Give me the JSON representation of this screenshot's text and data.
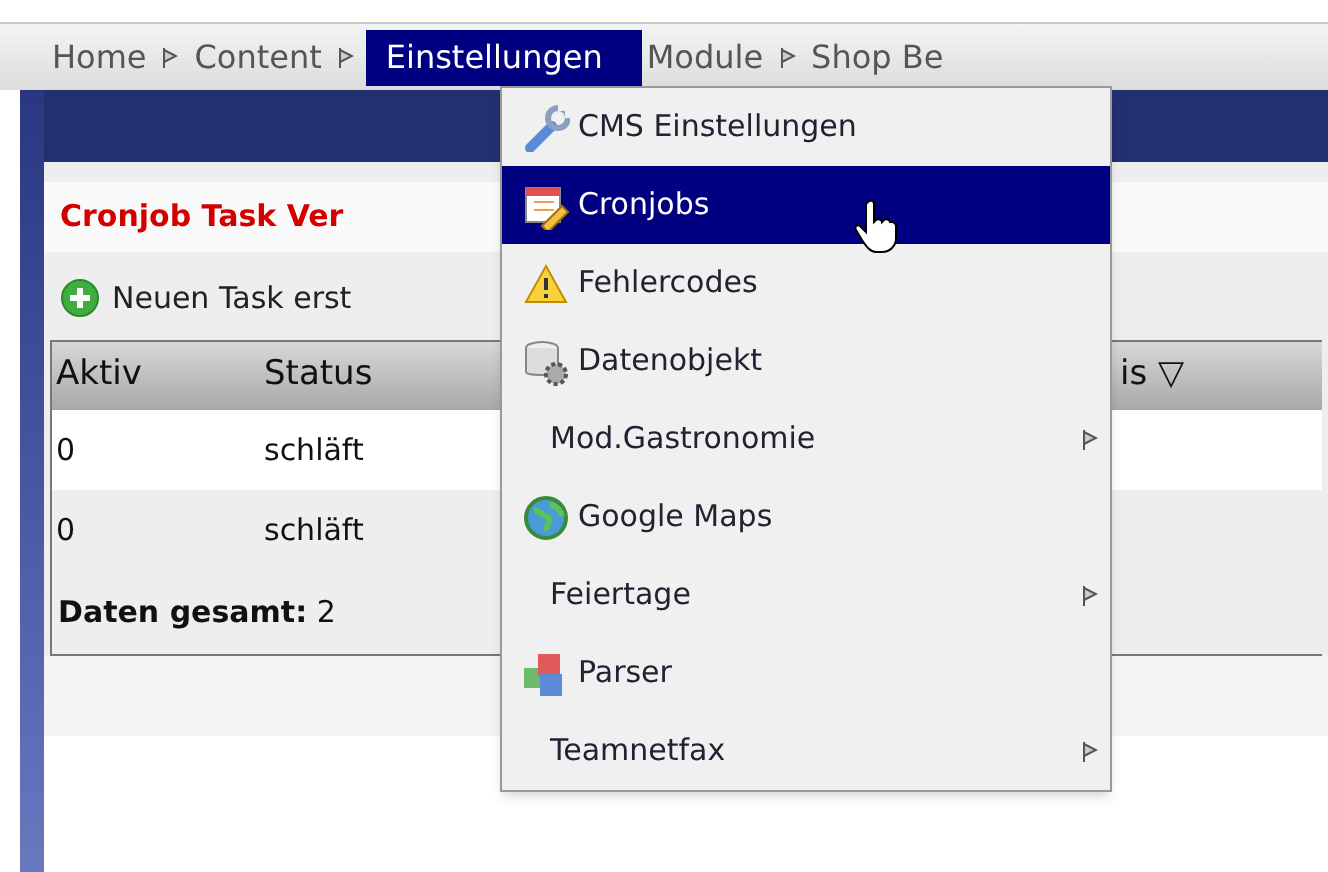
{
  "nav": [
    {
      "label": "Home",
      "selected": false,
      "arrow": true
    },
    {
      "label": "Content",
      "selected": false,
      "arrow": true
    },
    {
      "label": "Einstellungen",
      "selected": true,
      "arrow": false
    },
    {
      "label": "Module",
      "selected": false,
      "arrow": true
    },
    {
      "label": "Shop Be",
      "selected": false,
      "arrow": false
    }
  ],
  "panel": {
    "title": "Cronjob Task Ver",
    "new_task": "Neuen Task erst"
  },
  "table": {
    "columns": [
      "Aktiv",
      "Status",
      "is ▽"
    ],
    "rows": [
      [
        "0",
        "schläft"
      ],
      [
        "0",
        "schläft"
      ]
    ],
    "footer_label": "Daten gesamt:",
    "footer_value": "2"
  },
  "menu": [
    {
      "label": "CMS Einstellungen",
      "kind": "icon",
      "selected": false
    },
    {
      "label": "Cronjobs",
      "kind": "icon",
      "selected": true
    },
    {
      "label": "Fehlercodes",
      "kind": "icon",
      "selected": false
    },
    {
      "label": "Datenobjekt",
      "kind": "icon",
      "selected": false
    },
    {
      "label": "Mod.Gastronomie",
      "kind": "submenu",
      "selected": false
    },
    {
      "label": "Google Maps",
      "kind": "icon",
      "selected": false
    },
    {
      "label": "Feiertage",
      "kind": "submenu",
      "selected": false
    },
    {
      "label": "Parser",
      "kind": "icon",
      "selected": false
    },
    {
      "label": "Teamnetfax",
      "kind": "submenu",
      "selected": false
    }
  ]
}
